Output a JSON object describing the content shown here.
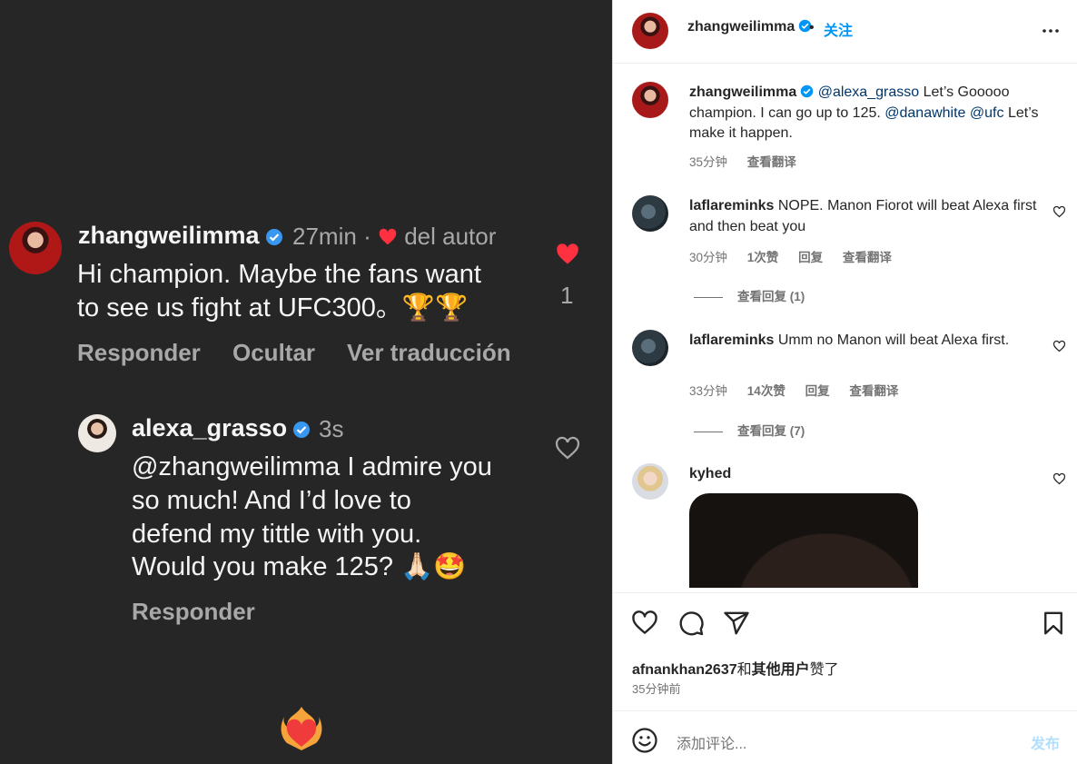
{
  "media": {
    "comment": {
      "username": "zhangweilimma",
      "time": "27min",
      "separator": "·",
      "liked_by_author": "del autor",
      "text_line1": "Hi champion. Maybe the fans want",
      "text_line2": "to see us fight at UFC300。🏆🏆",
      "like_count": "1",
      "actions": [
        "Responder",
        "Ocultar",
        "Ver traducción"
      ]
    },
    "reply": {
      "username": "alexa_grasso",
      "time": "3s",
      "text_line1": "@zhangweilimma I admire you",
      "text_line2": "so much! And I’d love to",
      "text_line3": "defend my tittle with you.",
      "text_line4": "Would you make 125? 🙏🏻🤩",
      "action": "Responder"
    }
  },
  "header": {
    "username": "zhangweilimma",
    "separator": "•",
    "follow_label": "关注"
  },
  "caption": {
    "username": "zhangweilimma",
    "text_part1": "@alexa_grasso",
    "text_part2": " Let’s Gooooo champion. I can go up to 125. ",
    "text_part3": "@danawhite",
    "text_part4": " ",
    "text_part5": "@ufc",
    "text_part6": " Let’s make it happen.",
    "time": "35分钟",
    "translate": "查看翻译"
  },
  "comments": [
    {
      "username": "laflareminks",
      "text": " NOPE. Manon Fiorot will beat Alexa first and then beat you",
      "time": "30分钟",
      "likes": "1次赞",
      "reply": "回复",
      "translate": "查看翻译",
      "view_replies": "查看回复 (1)"
    },
    {
      "username": "laflareminks",
      "text": " Umm no Manon will beat Alexa first.",
      "time": "33分钟",
      "likes": "14次赞",
      "reply": "回复",
      "translate": "查看翻译",
      "view_replies": "查看回复 (7)"
    },
    {
      "username": "kyhed"
    }
  ],
  "liked_by": {
    "user": "afnankhan2637",
    "joiner": "和",
    "others": "其他用户",
    "suffix": "赞了"
  },
  "post_time": "35分钟前",
  "add_comment": {
    "placeholder": "添加评论...",
    "post_label": "发布"
  },
  "colors": {
    "accent": "#0095f6",
    "verified": "#0095f6",
    "heart_red": "#ff3040",
    "mention": "#00376b"
  }
}
